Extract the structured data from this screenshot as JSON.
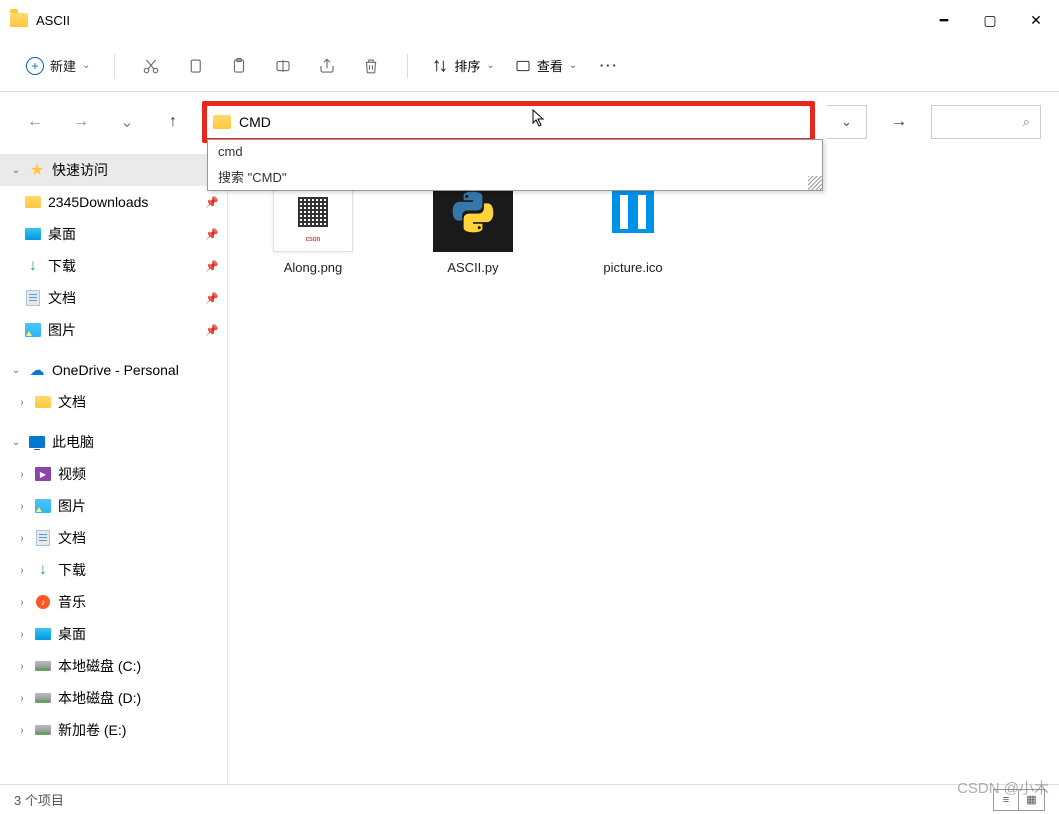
{
  "titlebar": {
    "title": "ASCII"
  },
  "toolbar": {
    "new_label": "新建",
    "sort_label": "排序",
    "view_label": "查看",
    "more": "···"
  },
  "address": {
    "input_value": "CMD",
    "dropdown": {
      "row1": "cmd",
      "row2": "搜索 \"CMD\""
    }
  },
  "sidebar": {
    "quick": {
      "label": "快速访问"
    },
    "quick_items": [
      {
        "label": "2345Downloads"
      },
      {
        "label": "桌面"
      },
      {
        "label": "下载"
      },
      {
        "label": "文档"
      },
      {
        "label": "图片"
      }
    ],
    "onedrive": {
      "label": "OneDrive - Personal"
    },
    "onedrive_items": [
      {
        "label": "文档"
      }
    ],
    "pc": {
      "label": "此电脑"
    },
    "pc_items": [
      {
        "label": "视频"
      },
      {
        "label": "图片"
      },
      {
        "label": "文档"
      },
      {
        "label": "下载"
      },
      {
        "label": "音乐"
      },
      {
        "label": "桌面"
      },
      {
        "label": "本地磁盘 (C:)"
      },
      {
        "label": "本地磁盘 (D:)"
      },
      {
        "label": "新加卷 (E:)"
      }
    ]
  },
  "files": [
    {
      "name": "Along.png"
    },
    {
      "name": "ASCII.py"
    },
    {
      "name": "picture.ico"
    }
  ],
  "status": {
    "count": "3 个项目"
  },
  "watermark": "CSDN @小木"
}
